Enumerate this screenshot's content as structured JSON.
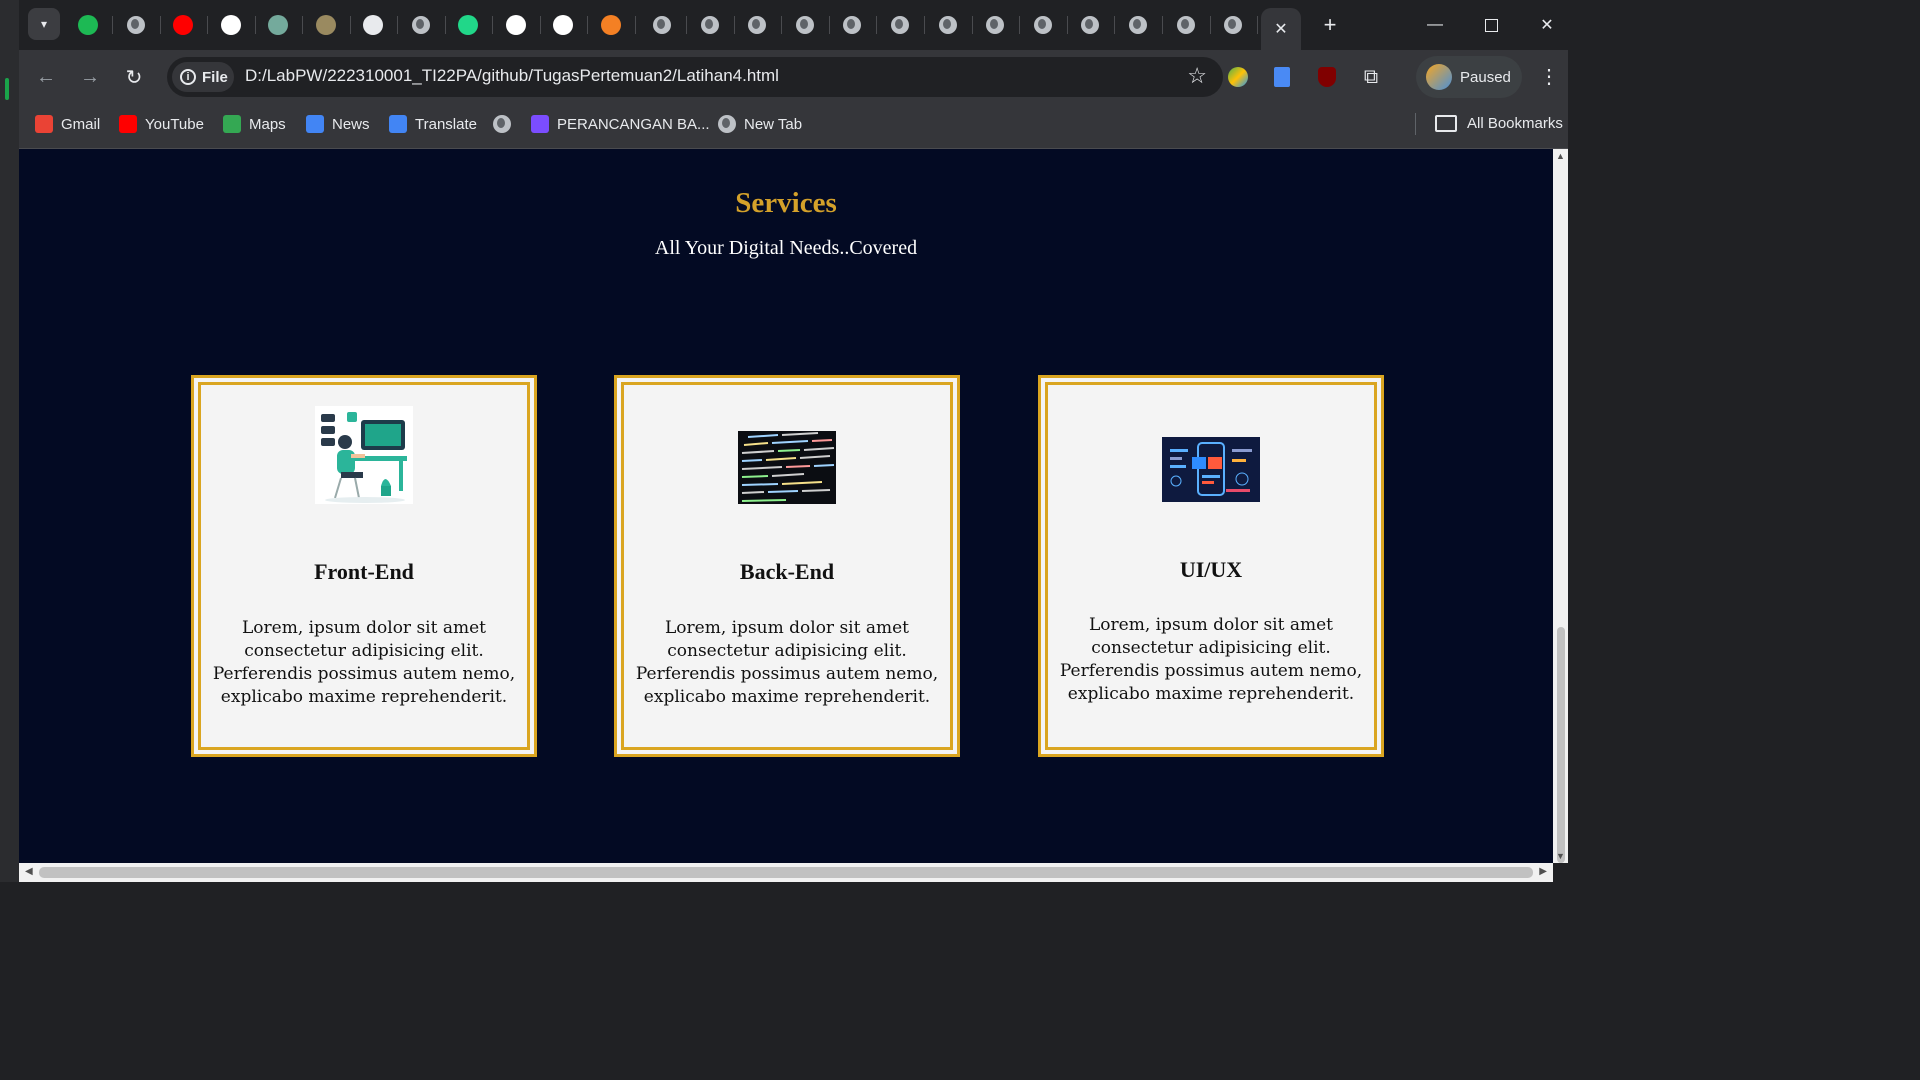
{
  "browser": {
    "url": "D:/LabPW/222310001_TI22PA/github/TugasPertemuan2/Latihan4.html",
    "site_chip": "File",
    "profile_status": "Paused",
    "tabs": [
      {
        "icon": "spotify-icon",
        "color": "#1db954"
      },
      {
        "icon": "globe-icon",
        "color": "#bdc1c6"
      },
      {
        "icon": "youtube-icon",
        "color": "#ff0000"
      },
      {
        "icon": "chatgpt-icon",
        "color": "#ffffff"
      },
      {
        "icon": "chatgpt-icon",
        "color": "#74aa9c"
      },
      {
        "icon": "emblem-icon",
        "color": "#9a8a60"
      },
      {
        "icon": "document-icon",
        "color": "#e8eaed"
      },
      {
        "icon": "globe-icon",
        "color": "#bdc1c6"
      },
      {
        "icon": "pycharm-icon",
        "color": "#21d789"
      },
      {
        "icon": "yu-icon",
        "color": "#ffffff"
      },
      {
        "icon": "github-icon",
        "color": "#ffffff"
      },
      {
        "icon": "stackoverflow-icon",
        "color": "#f48024"
      }
    ]
  },
  "bookmarks": {
    "items": [
      {
        "label": "Gmail",
        "icon": "gmail-icon",
        "color": "#ea4335"
      },
      {
        "label": "YouTube",
        "icon": "youtube-icon",
        "color": "#ff0000"
      },
      {
        "label": "Maps",
        "icon": "maps-icon",
        "color": "#34a853"
      },
      {
        "label": "News",
        "icon": "news-icon",
        "color": "#4285f4"
      },
      {
        "label": "Translate",
        "icon": "translate-icon",
        "color": "#4285f4"
      },
      {
        "label": "",
        "icon": "globe-icon",
        "color": "#bdc1c6"
      },
      {
        "label": "PERANCANGAN BA...",
        "icon": "app-icon",
        "color": "#7b4dff"
      },
      {
        "label": "New Tab",
        "icon": "globe-icon",
        "color": "#bdc1c6"
      }
    ],
    "all_label": "All Bookmarks"
  },
  "page": {
    "title": "Services",
    "subtitle": "All Your Digital Needs..Covered",
    "title_color": "#d4a12a",
    "background": "#030a23",
    "cards": [
      {
        "title": "Front-End",
        "text": "Lorem, ipsum dolor sit amet consectetur adipisicing elit. Perferendis possimus autem nemo, explicabo maxime reprehenderit.",
        "image": "front-end-illustration"
      },
      {
        "title": "Back-End",
        "text": "Lorem, ipsum dolor sit amet consectetur adipisicing elit. Perferendis possimus autem nemo, explicabo maxime reprehenderit.",
        "image": "code-screen-photo"
      },
      {
        "title": "UI/UX",
        "text": "Lorem, ipsum dolor sit amet consectetur adipisicing elit. Perferendis possimus autem nemo, explicabo maxime reprehenderit.",
        "image": "ui-ux-illustration"
      }
    ]
  }
}
